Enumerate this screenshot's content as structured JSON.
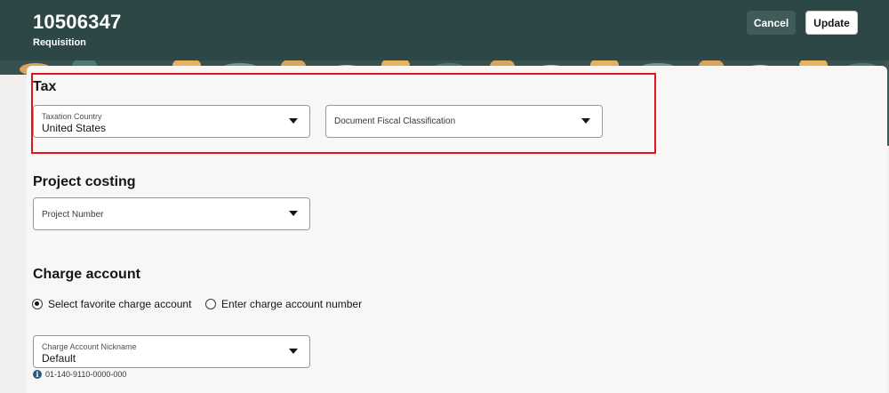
{
  "header": {
    "requisition_number": "10506347",
    "subtitle": "Requisition",
    "cancel_label": "Cancel",
    "update_label": "Update"
  },
  "tax": {
    "title": "Tax",
    "taxation_country": {
      "label": "Taxation Country",
      "value": "United States"
    },
    "fiscal_classification": {
      "placeholder": "Document Fiscal Classification"
    }
  },
  "project_costing": {
    "title": "Project costing",
    "project_number": {
      "placeholder": "Project Number"
    }
  },
  "charge_account": {
    "title": "Charge account",
    "options": [
      {
        "label": "Select favorite charge account",
        "selected": true
      },
      {
        "label": "Enter charge account number",
        "selected": false
      }
    ],
    "nickname": {
      "label": "Charge Account Nickname",
      "value": "Default"
    },
    "account_number": "01-140-9110-0000-000"
  },
  "colors": {
    "header_bg": "#2c4746",
    "highlight": "#e0161c",
    "card_bg": "#f8f7f5"
  }
}
